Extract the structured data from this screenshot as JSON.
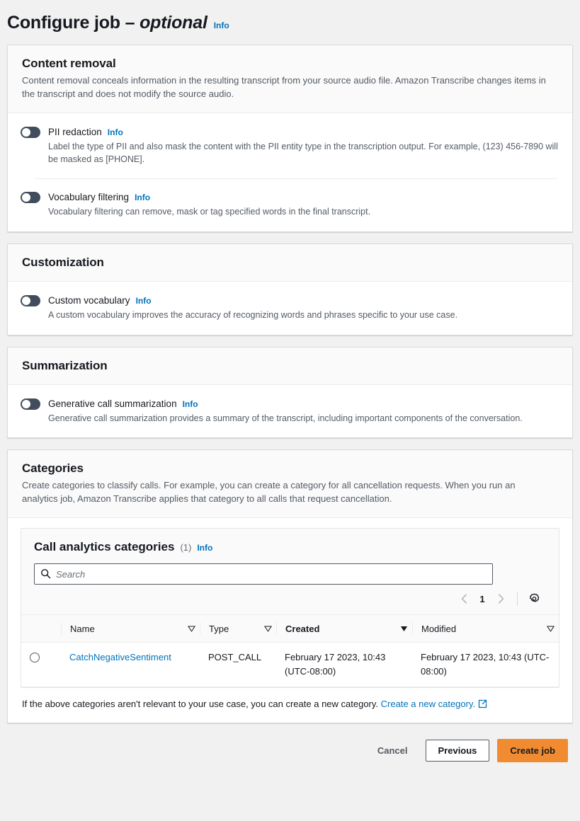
{
  "page": {
    "title_main": "Configure job",
    "title_sep": " – ",
    "title_optional": "optional",
    "info_label": "Info"
  },
  "colors": {
    "link": "#0073bb",
    "primary_button": "#f08b31",
    "toggle_off": "#414d5c",
    "page_bg": "#f1f1f1"
  },
  "sections": {
    "content_removal": {
      "title": "Content removal",
      "description": "Content removal conceals information in the resulting transcript from your source audio file. Amazon Transcribe changes items in the transcript and does not modify the source audio.",
      "toggles": [
        {
          "label": "PII redaction",
          "info_label": "Info",
          "state": "off",
          "description": "Label the type of PII and also mask the content with the PII entity type in the transcription output. For example, (123) 456-7890 will be masked as [PHONE]."
        },
        {
          "label": "Vocabulary filtering",
          "info_label": "Info",
          "state": "off",
          "description": "Vocabulary filtering can remove, mask or tag specified words in the final transcript."
        }
      ]
    },
    "customization": {
      "title": "Customization",
      "toggles": [
        {
          "label": "Custom vocabulary",
          "info_label": "Info",
          "state": "off",
          "description": "A custom vocabulary improves the accuracy of recognizing words and phrases specific to your use case."
        }
      ]
    },
    "summarization": {
      "title": "Summarization",
      "toggles": [
        {
          "label": "Generative call summarization",
          "info_label": "Info",
          "state": "off",
          "description": "Generative call summarization provides a summary of the transcript, including important components of the conversation."
        }
      ]
    },
    "categories": {
      "title": "Categories",
      "description": "Create categories to classify calls. For example, you can create a category for all cancellation requests. When you run an analytics job, Amazon Transcribe applies that category to all calls that request cancellation.",
      "panel": {
        "title": "Call analytics categories",
        "count": "(1)",
        "info_label": "Info",
        "search": {
          "placeholder": "Search",
          "value": ""
        },
        "pagination": {
          "prev_icon": "chevron-left-icon",
          "current_page": "1",
          "next_icon": "chevron-right-icon",
          "settings_icon": "gear-icon"
        },
        "table": {
          "columns": [
            {
              "label": "Name",
              "sorted": false
            },
            {
              "label": "Type",
              "sorted": false
            },
            {
              "label": "Created",
              "sorted": true
            },
            {
              "label": "Modified",
              "sorted": false
            }
          ],
          "rows": [
            {
              "selected": false,
              "name": "CatchNegativeSentiment",
              "type": "POST_CALL",
              "created": "February 17 2023, 10:43 (UTC-08:00)",
              "modified": "February 17 2023, 10:43 (UTC-08:00)"
            }
          ]
        },
        "footer_note_text": "If the above categories aren't relevant to your use case, you can create a new category.",
        "footer_link_label": "Create a new category.",
        "footer_link_icon": "external-link-icon"
      }
    }
  },
  "actions": {
    "cancel_label": "Cancel",
    "previous_label": "Previous",
    "create_label": "Create job"
  }
}
